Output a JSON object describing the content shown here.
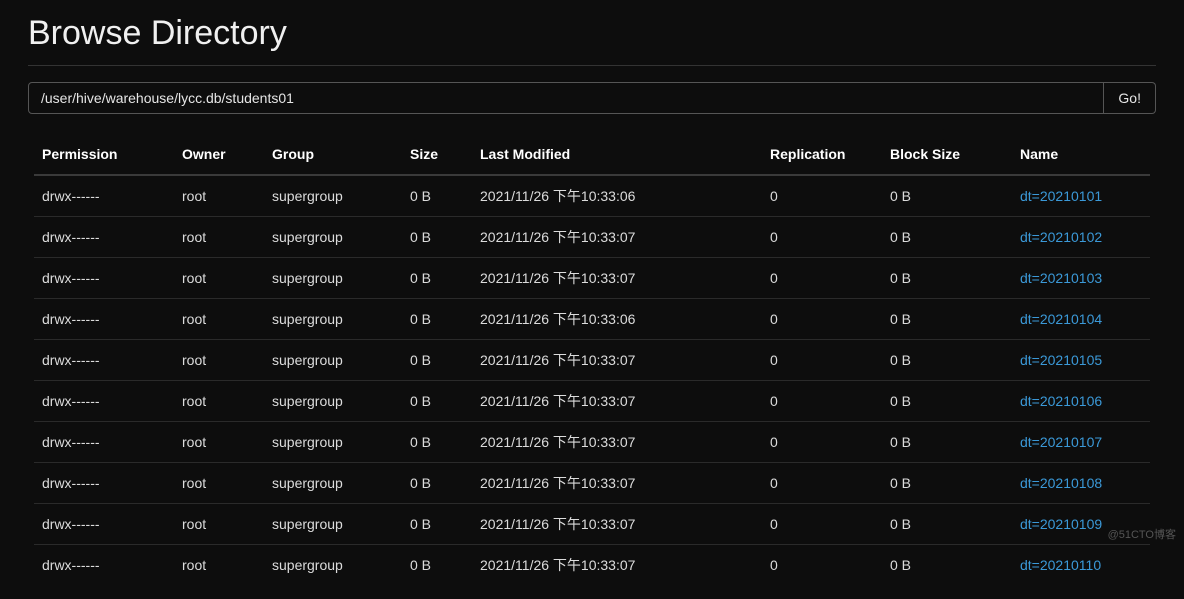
{
  "page": {
    "title": "Browse Directory"
  },
  "path": {
    "value": "/user/hive/warehouse/lycc.db/students01",
    "go_label": "Go!"
  },
  "table": {
    "headers": {
      "permission": "Permission",
      "owner": "Owner",
      "group": "Group",
      "size": "Size",
      "last_modified": "Last Modified",
      "replication": "Replication",
      "block_size": "Block Size",
      "name": "Name"
    },
    "rows": [
      {
        "permission": "drwx------",
        "owner": "root",
        "group": "supergroup",
        "size": "0 B",
        "last_modified": "2021/11/26 下午10:33:06",
        "replication": "0",
        "block_size": "0 B",
        "name": "dt=20210101"
      },
      {
        "permission": "drwx------",
        "owner": "root",
        "group": "supergroup",
        "size": "0 B",
        "last_modified": "2021/11/26 下午10:33:07",
        "replication": "0",
        "block_size": "0 B",
        "name": "dt=20210102"
      },
      {
        "permission": "drwx------",
        "owner": "root",
        "group": "supergroup",
        "size": "0 B",
        "last_modified": "2021/11/26 下午10:33:07",
        "replication": "0",
        "block_size": "0 B",
        "name": "dt=20210103"
      },
      {
        "permission": "drwx------",
        "owner": "root",
        "group": "supergroup",
        "size": "0 B",
        "last_modified": "2021/11/26 下午10:33:06",
        "replication": "0",
        "block_size": "0 B",
        "name": "dt=20210104"
      },
      {
        "permission": "drwx------",
        "owner": "root",
        "group": "supergroup",
        "size": "0 B",
        "last_modified": "2021/11/26 下午10:33:07",
        "replication": "0",
        "block_size": "0 B",
        "name": "dt=20210105"
      },
      {
        "permission": "drwx------",
        "owner": "root",
        "group": "supergroup",
        "size": "0 B",
        "last_modified": "2021/11/26 下午10:33:07",
        "replication": "0",
        "block_size": "0 B",
        "name": "dt=20210106"
      },
      {
        "permission": "drwx------",
        "owner": "root",
        "group": "supergroup",
        "size": "0 B",
        "last_modified": "2021/11/26 下午10:33:07",
        "replication": "0",
        "block_size": "0 B",
        "name": "dt=20210107"
      },
      {
        "permission": "drwx------",
        "owner": "root",
        "group": "supergroup",
        "size": "0 B",
        "last_modified": "2021/11/26 下午10:33:07",
        "replication": "0",
        "block_size": "0 B",
        "name": "dt=20210108"
      },
      {
        "permission": "drwx------",
        "owner": "root",
        "group": "supergroup",
        "size": "0 B",
        "last_modified": "2021/11/26 下午10:33:07",
        "replication": "0",
        "block_size": "0 B",
        "name": "dt=20210109"
      },
      {
        "permission": "drwx------",
        "owner": "root",
        "group": "supergroup",
        "size": "0 B",
        "last_modified": "2021/11/26 下午10:33:07",
        "replication": "0",
        "block_size": "0 B",
        "name": "dt=20210110"
      }
    ]
  },
  "watermark": "@51CTO博客"
}
